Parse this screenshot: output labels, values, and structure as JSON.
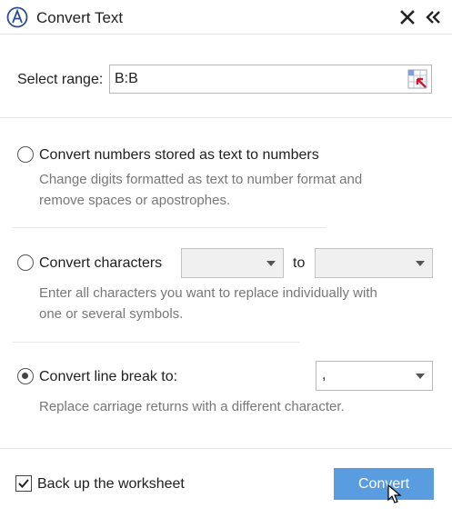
{
  "header": {
    "title": "Convert Text",
    "logo_icon": "ablebits-logo-icon",
    "close_icon": "close-icon",
    "collapse_icon": "double-chevron-left-icon"
  },
  "range": {
    "label": "Select range:",
    "value": "B:B",
    "picker_icon": "range-select-icon"
  },
  "options": {
    "numbers": {
      "label": "Convert numbers stored as text to numbers",
      "description_line1": "Change digits formatted as text to number format and",
      "description_line2": "remove spaces or apostrophes.",
      "checked": false
    },
    "characters": {
      "label": "Convert characters",
      "from_value": "",
      "to_label": "to",
      "to_value": "",
      "description_line1": "Enter all characters you want to replace individually with",
      "description_line2": "one or several symbols.",
      "checked": false
    },
    "line_break": {
      "label": "Convert line break to:",
      "value": ",",
      "description": "Replace carriage returns with a different character.",
      "checked": true
    }
  },
  "footer": {
    "backup_label": "Back up the worksheet",
    "backup_checked": true,
    "convert_label": "Convert"
  },
  "colors": {
    "accent": "#5a9ce0",
    "border": "#e3e3e3",
    "description_text": "#777777"
  }
}
